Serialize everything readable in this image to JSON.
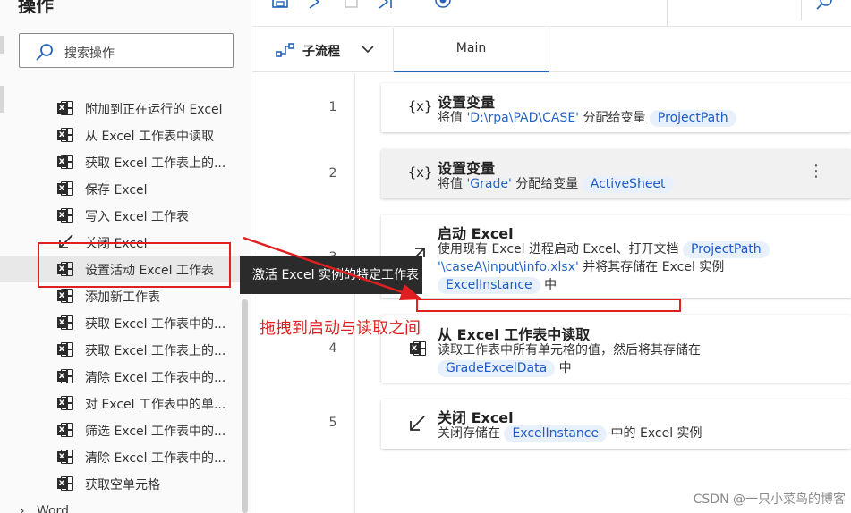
{
  "left_pane": {
    "title": "操作",
    "search_placeholder": "搜索操作",
    "items": [
      {
        "label": "附加到正在运行的 Excel",
        "icon": "excel-icon"
      },
      {
        "label": "从 Excel 工作表中读取",
        "icon": "excel-icon"
      },
      {
        "label": "获取 Excel 工作表上的...",
        "icon": "excel-icon"
      },
      {
        "label": "保存 Excel",
        "icon": "excel-icon"
      },
      {
        "label": "写入 Excel 工作表",
        "icon": "excel-icon"
      },
      {
        "label": "关闭 Excel",
        "icon": "close-arrow-icon"
      },
      {
        "label": "设置活动 Excel 工作表",
        "icon": "excel-icon"
      },
      {
        "label": "添加新工作表",
        "icon": "excel-icon"
      },
      {
        "label": "获取 Excel 工作表中的...",
        "icon": "excel-icon"
      },
      {
        "label": "获取 Excel 工作表上的...",
        "icon": "excel-icon"
      },
      {
        "label": "清除 Excel 工作表中的...",
        "icon": "excel-icon"
      },
      {
        "label": "对 Excel 工作表中的单...",
        "icon": "excel-icon"
      },
      {
        "label": "筛选 Excel 工作表中的...",
        "icon": "excel-icon"
      },
      {
        "label": "清除 Excel 工作表中的...",
        "icon": "excel-icon"
      },
      {
        "label": "获取空单元格",
        "icon": "excel-icon"
      }
    ],
    "next_group": "Word"
  },
  "tooltip": "激活 Excel 实例的特定工作表",
  "tabs": {
    "subflow_label": "子流程",
    "main_label": "Main"
  },
  "flow": {
    "steps": [
      {
        "num": "1",
        "title": "设置变量",
        "desc_pre": "将值 ",
        "literal": "'D:\\rpa\\PAD\\CASE'",
        "desc_mid": " 分配给变量 ",
        "var": "ProjectPath"
      },
      {
        "num": "2",
        "title": "设置变量",
        "desc_pre": "将值 ",
        "literal": "'Grade'",
        "desc_mid": " 分配给变量 ",
        "var": "ActiveSheet"
      },
      {
        "num": "3",
        "title": "启动 Excel",
        "line1": "使用现有 Excel 进程启动 Excel、打开文档 ",
        "var1": "ProjectPath",
        "literal": "'\\caseA\\input\\info.xlsx'",
        "line2_rest": " 并将其存储在 Excel 实例",
        "var2": "ExcelInstance",
        "line3_rest": " 中"
      },
      {
        "num": "4",
        "title": "从 Excel 工作表中读取",
        "line1": "读取工作表中所有单元格的值，然后将其存储在",
        "var": "GradeExcelData",
        "line2_rest": " 中"
      },
      {
        "num": "5",
        "title": "关闭 Excel",
        "desc_pre": "关闭存储在 ",
        "var": "ExcelInstance",
        "desc_post": " 中的 Excel 实例"
      }
    ]
  },
  "annotation": "拖拽到启动与读取之间",
  "watermark": "CSDN @一只小菜鸟的博客",
  "colors": {
    "accent": "#2563b8",
    "annotation_red": "#e02020",
    "variable_chip_bg": "#e8f0fc",
    "variable_text": "#1e5bc6"
  }
}
